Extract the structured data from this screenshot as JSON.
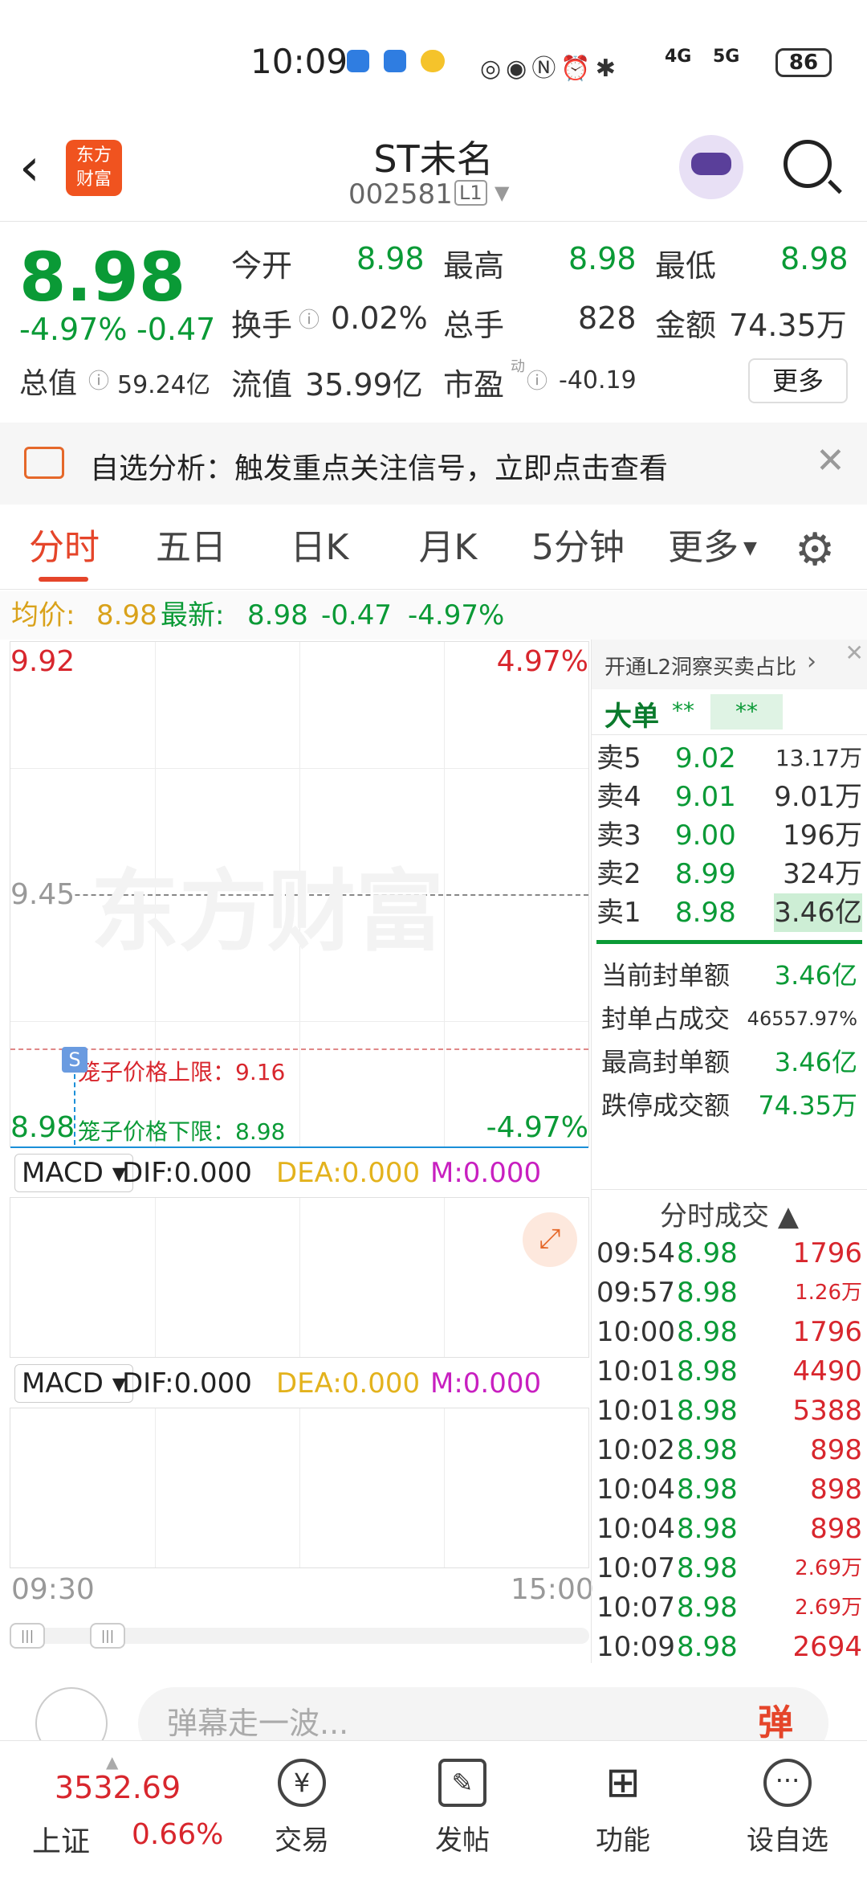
{
  "status": {
    "time": "10:09",
    "battery": "86",
    "net1": "4G",
    "net2": "5G"
  },
  "header": {
    "name": "ST未名",
    "code": "002581",
    "level": "L1",
    "logo_line1": "东方",
    "logo_line2": "财富"
  },
  "quote": {
    "price": "8.98",
    "pct": "-4.97%",
    "chg": "-0.47",
    "open_l": "今开",
    "open_v": "8.98",
    "high_l": "最高",
    "high_v": "8.98",
    "low_l": "最低",
    "low_v": "8.98",
    "turn_l": "换手",
    "turn_v": "0.02%",
    "vol_l": "总手",
    "vol_v": "828",
    "amt_l": "金额",
    "amt_v": "74.35万",
    "mcap_l": "总值",
    "mcap_v": "59.24亿",
    "float_l": "流值",
    "float_v": "35.99亿",
    "pe_l": "市盈",
    "pe_sup": "动",
    "pe_v": "-40.19",
    "more": "更多"
  },
  "banner": {
    "text": "自选分析：触发重点关注信号，立即点击查看"
  },
  "tabs": [
    "分时",
    "五日",
    "日K",
    "月K",
    "5分钟",
    "更多"
  ],
  "avg": {
    "avg_l": "均价:",
    "avg_v": "8.98",
    "new_l": "最新:",
    "new_v": "8.98",
    "chg": "-0.47",
    "pct": "-4.97%"
  },
  "chart": {
    "top": "9.92",
    "top_pct": "4.97%",
    "mid": "9.45",
    "bottom": "8.98",
    "bottom_pct": "-4.97%",
    "upper": "笼子价格上限：9.16",
    "lower": "笼子价格下限：8.98",
    "t_start": "09:30",
    "t_end": "15:00",
    "watermark": "东方财富",
    "marker": "S"
  },
  "macd1": {
    "name": "MACD",
    "dif": "DIF:0.000",
    "dea": "DEA:0.000",
    "m": "M:0.000"
  },
  "macd2": {
    "name": "MACD",
    "dif": "DIF:0.000",
    "dea": "DEA:0.000",
    "m": "M:0.000"
  },
  "l2": {
    "title": "开通L2洞察买卖占比",
    "big": "大单",
    "s1": "**",
    "s2": "**"
  },
  "asks": [
    {
      "l": "卖5",
      "p": "9.02",
      "v": "13.17万"
    },
    {
      "l": "卖4",
      "p": "9.01",
      "v": "9.01万"
    },
    {
      "l": "卖3",
      "p": "9.00",
      "v": "196万"
    },
    {
      "l": "卖2",
      "p": "8.99",
      "v": "324万"
    },
    {
      "l": "卖1",
      "p": "8.98",
      "v": "3.46亿"
    }
  ],
  "seal": [
    {
      "l": "当前封单额",
      "v": "3.46亿"
    },
    {
      "l": "封单占成交",
      "v": "46557.97%"
    },
    {
      "l": "最高封单额",
      "v": "3.46亿"
    },
    {
      "l": "跌停成交额",
      "v": "74.35万"
    }
  ],
  "trades_title": "分时成交",
  "trades": [
    {
      "t": "09:54",
      "p": "8.98",
      "v": "1796"
    },
    {
      "t": "09:57",
      "p": "8.98",
      "v": "1.26万"
    },
    {
      "t": "10:00",
      "p": "8.98",
      "v": "1796"
    },
    {
      "t": "10:01",
      "p": "8.98",
      "v": "4490"
    },
    {
      "t": "10:01",
      "p": "8.98",
      "v": "5388"
    },
    {
      "t": "10:02",
      "p": "8.98",
      "v": "898"
    },
    {
      "t": "10:04",
      "p": "8.98",
      "v": "898"
    },
    {
      "t": "10:04",
      "p": "8.98",
      "v": "898"
    },
    {
      "t": "10:07",
      "p": "8.98",
      "v": "2.69万"
    },
    {
      "t": "10:07",
      "p": "8.98",
      "v": "2.69万"
    },
    {
      "t": "10:09",
      "p": "8.98",
      "v": "2694"
    }
  ],
  "danmu": {
    "placeholder": "弹幕走一波...",
    "btn": "弹"
  },
  "bottom": {
    "idx_v": "3532.69",
    "idx_l": "上证",
    "idx_p": "0.66%",
    "n1": "交易",
    "n2": "发帖",
    "n3": "功能",
    "n4": "设自选"
  }
}
